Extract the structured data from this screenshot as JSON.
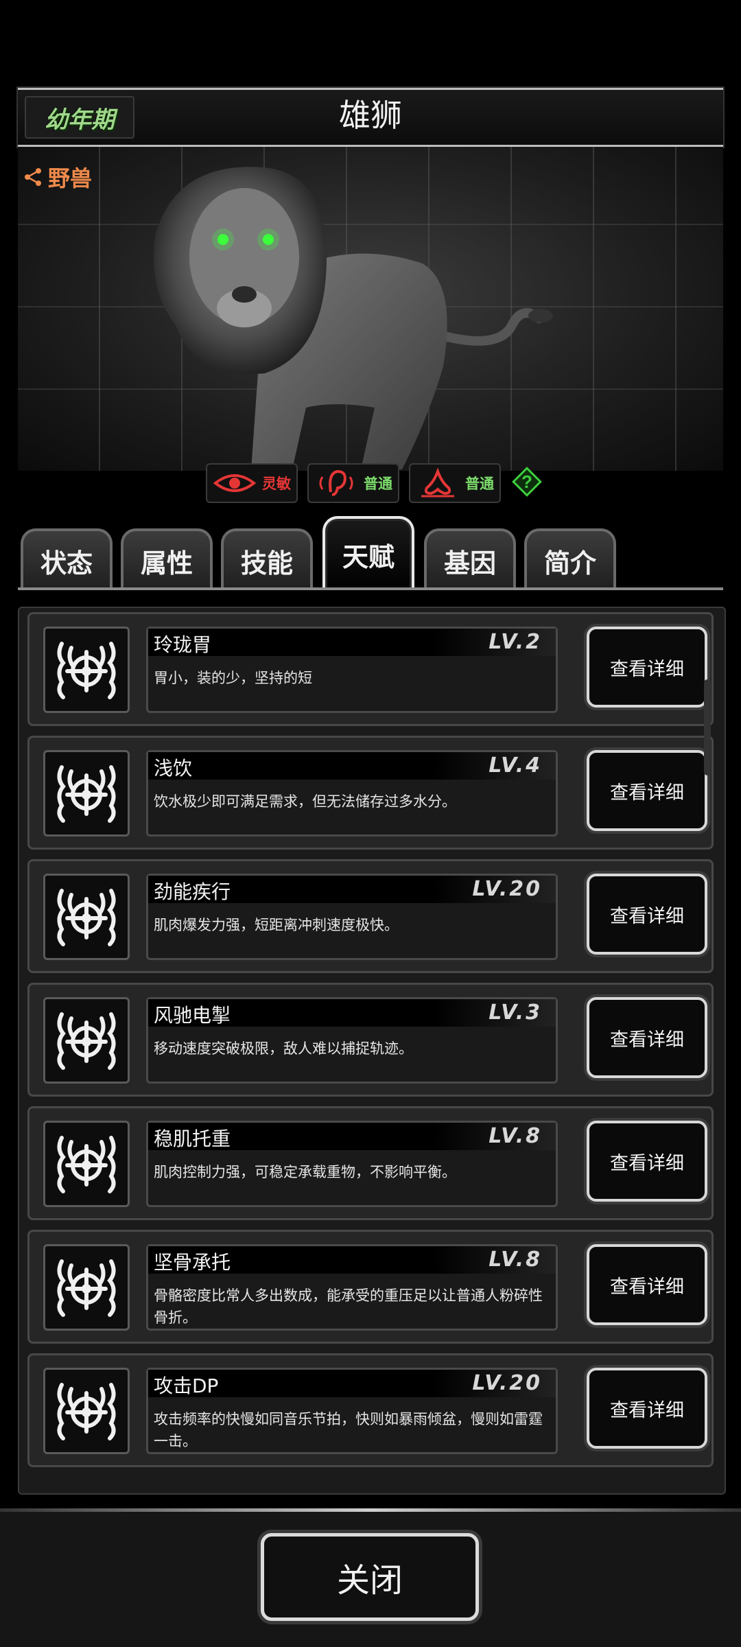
{
  "header": {
    "stage": "幼年期",
    "title": "雄狮"
  },
  "category": {
    "label": "野兽"
  },
  "senses": [
    {
      "icon": "eye-icon",
      "value": "灵敏",
      "color": "#e53636"
    },
    {
      "icon": "ear-icon",
      "value": "普通",
      "color": "#7ddc6b"
    },
    {
      "icon": "nose-icon",
      "value": "普通",
      "color": "#7ddc6b"
    }
  ],
  "tabs": [
    "状态",
    "属性",
    "技能",
    "天赋",
    "基因",
    "简介"
  ],
  "active_tab": "天赋",
  "talents": [
    {
      "name": "玲珑胃",
      "level": "LV.2",
      "desc": "胃小，装的少，坚持的短",
      "button": "查看详细"
    },
    {
      "name": "浅饮",
      "level": "LV.4",
      "desc": "饮水极少即可满足需求，但无法储存过多水分。",
      "button": "查看详细"
    },
    {
      "name": "劲能疾行",
      "level": "LV.20",
      "desc": "肌肉爆发力强，短距离冲刺速度极快。",
      "button": "查看详细"
    },
    {
      "name": "风驰电掣",
      "level": "LV.3",
      "desc": "移动速度突破极限，敌人难以捕捉轨迹。",
      "button": "查看详细"
    },
    {
      "name": "稳肌托重",
      "level": "LV.8",
      "desc": "肌肉控制力强，可稳定承载重物，不影响平衡。",
      "button": "查看详细"
    },
    {
      "name": "坚骨承托",
      "level": "LV.8",
      "desc": "骨骼密度比常人多出数成，能承受的重压足以让普通人粉碎性骨折。",
      "button": "查看详细"
    },
    {
      "name": "攻击DP",
      "level": "LV.20",
      "desc": "攻击频率的快慢如同音乐节拍，快则如暴雨倾盆，慢则如雷霆一击。",
      "button": "查看详细"
    }
  ],
  "footer": {
    "close_label": "关闭"
  },
  "colors": {
    "stage_text": "#9fd88a",
    "category_text": "#f08a4b",
    "accent_red": "#e53636",
    "accent_green": "#7ddc6b"
  }
}
